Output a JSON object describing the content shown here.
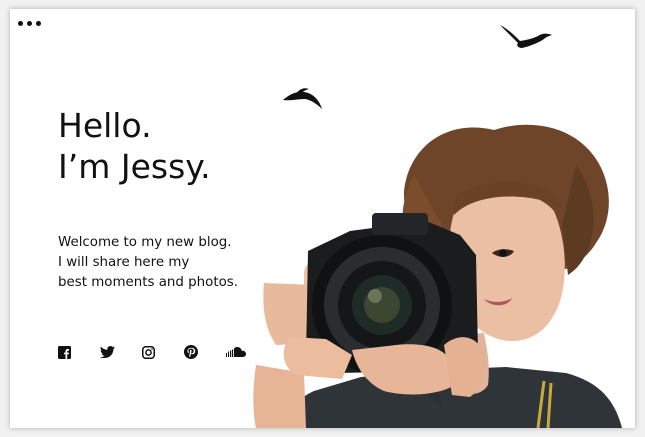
{
  "hero": {
    "greeting": "Hello.",
    "name_line": "I’m Jessy."
  },
  "intro": {
    "line1": "Welcome to my new blog.",
    "line2": "I will share here my",
    "line3": "best moments and photos."
  },
  "social": [
    {
      "icon": "facebook-icon"
    },
    {
      "icon": "twitter-icon"
    },
    {
      "icon": "instagram-icon"
    },
    {
      "icon": "pinterest-icon"
    },
    {
      "icon": "soundcloud-icon"
    }
  ],
  "header": {
    "menu_icon": "more-dots-icon"
  },
  "decor": {
    "bird_color": "#111111"
  },
  "photo": {
    "subject": "photographer-with-camera-image"
  },
  "colors": {
    "text": "#111111",
    "background": "#ffffff",
    "frame": "#f1f1f1"
  }
}
